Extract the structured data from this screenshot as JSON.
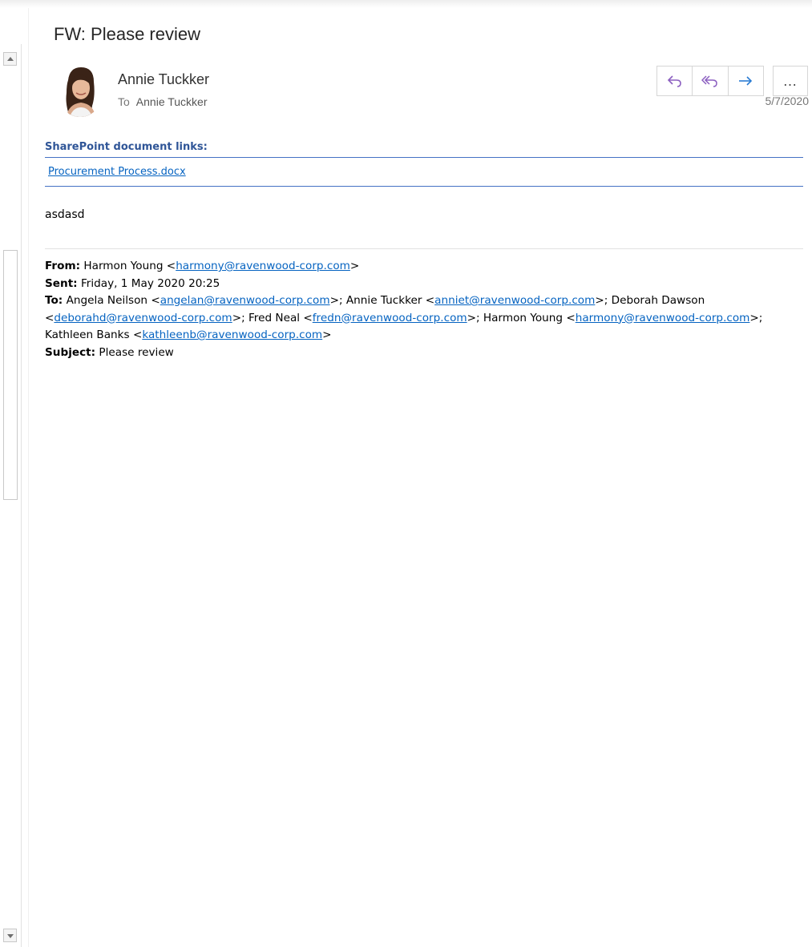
{
  "message": {
    "subject": "FW: Please review",
    "sender_name": "Annie Tuckker",
    "to_label": "To",
    "to_name": "Annie Tuckker",
    "date": "5/7/2020"
  },
  "actions": {
    "reply_icon": "reply-icon",
    "reply_all_icon": "reply-all-icon",
    "forward_icon": "forward-icon",
    "more_label": "…",
    "reply_color": "#8b5fc0",
    "forward_color": "#2b7cd3"
  },
  "sharepoint": {
    "header": "SharePoint document links:",
    "link": "Procurement Process.docx"
  },
  "body": {
    "text": "asdasd"
  },
  "forwarded": {
    "from_label": "From:",
    "from_name": "Harmon Young <",
    "from_email": "harmony@ravenwood-corp.com",
    "from_close": ">",
    "sent_label": "Sent:",
    "sent_value": "Friday, 1 May 2020 20:25",
    "to_label": "To:",
    "to_1_name": "Angela Neilson <",
    "to_1_email": "angelan@ravenwood-corp.com",
    "to_2_name": ">; Annie Tuckker <",
    "to_2_email": "anniet@ravenwood-corp.com",
    "to_3_name": ">; Deborah Dawson <",
    "to_3_email": "deborahd@ravenwood-corp.com",
    "to_4_name": ">; Fred Neal <",
    "to_4_email": "fredn@ravenwood-corp.com",
    "to_5_name": ">; Harmon Young <",
    "to_5_email": "harmony@ravenwood-corp.com",
    "to_6_name": ">; Kathleen Banks <",
    "to_6_email": "kathleenb@ravenwood-corp.com",
    "to_end": ">",
    "subject_label": "Subject:",
    "subject_value": "Please review"
  },
  "colors": {
    "link": "#0563c1",
    "sharepoint_header": "#2f5597",
    "rule": "#4472c4"
  }
}
